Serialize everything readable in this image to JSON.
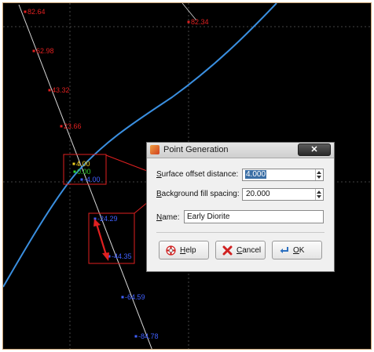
{
  "scene": {
    "background": "#000000",
    "curve_color": "#3a8fe0",
    "line_color": "#d8d8d8",
    "annot_color": "#e02020",
    "red_points": [
      "82.64",
      "62.98",
      "43.32",
      "23.66"
    ],
    "red_points_right": [
      "82.34"
    ],
    "cluster": {
      "yellow": "4.00",
      "green": "0.00",
      "blue": "-4.00"
    },
    "blue_points": [
      "-24.29",
      "-44.35",
      "-64.59",
      "-84.78"
    ],
    "colors": {
      "red": "#e02020",
      "yellow": "#f0d020",
      "green": "#30d030",
      "blue": "#4060ff"
    }
  },
  "dialog": {
    "title": "Point Generation",
    "close_label": "✕",
    "surface_offset": {
      "label_pre": "",
      "label_mnemonic": "S",
      "label_post": "urface offset distance:",
      "value": "4.000"
    },
    "background_fill": {
      "label_pre": "",
      "label_mnemonic": "B",
      "label_post": "ackground fill spacing:",
      "value": "20.000"
    },
    "name": {
      "label_pre": "",
      "label_mnemonic": "N",
      "label_post": "ame:",
      "value": "Early Diorite"
    },
    "buttons": {
      "help": {
        "mnemonic": "H",
        "rest": "elp"
      },
      "cancel": {
        "mnemonic": "C",
        "rest": "ancel"
      },
      "ok": {
        "mnemonic": "O",
        "rest": "K"
      }
    }
  }
}
